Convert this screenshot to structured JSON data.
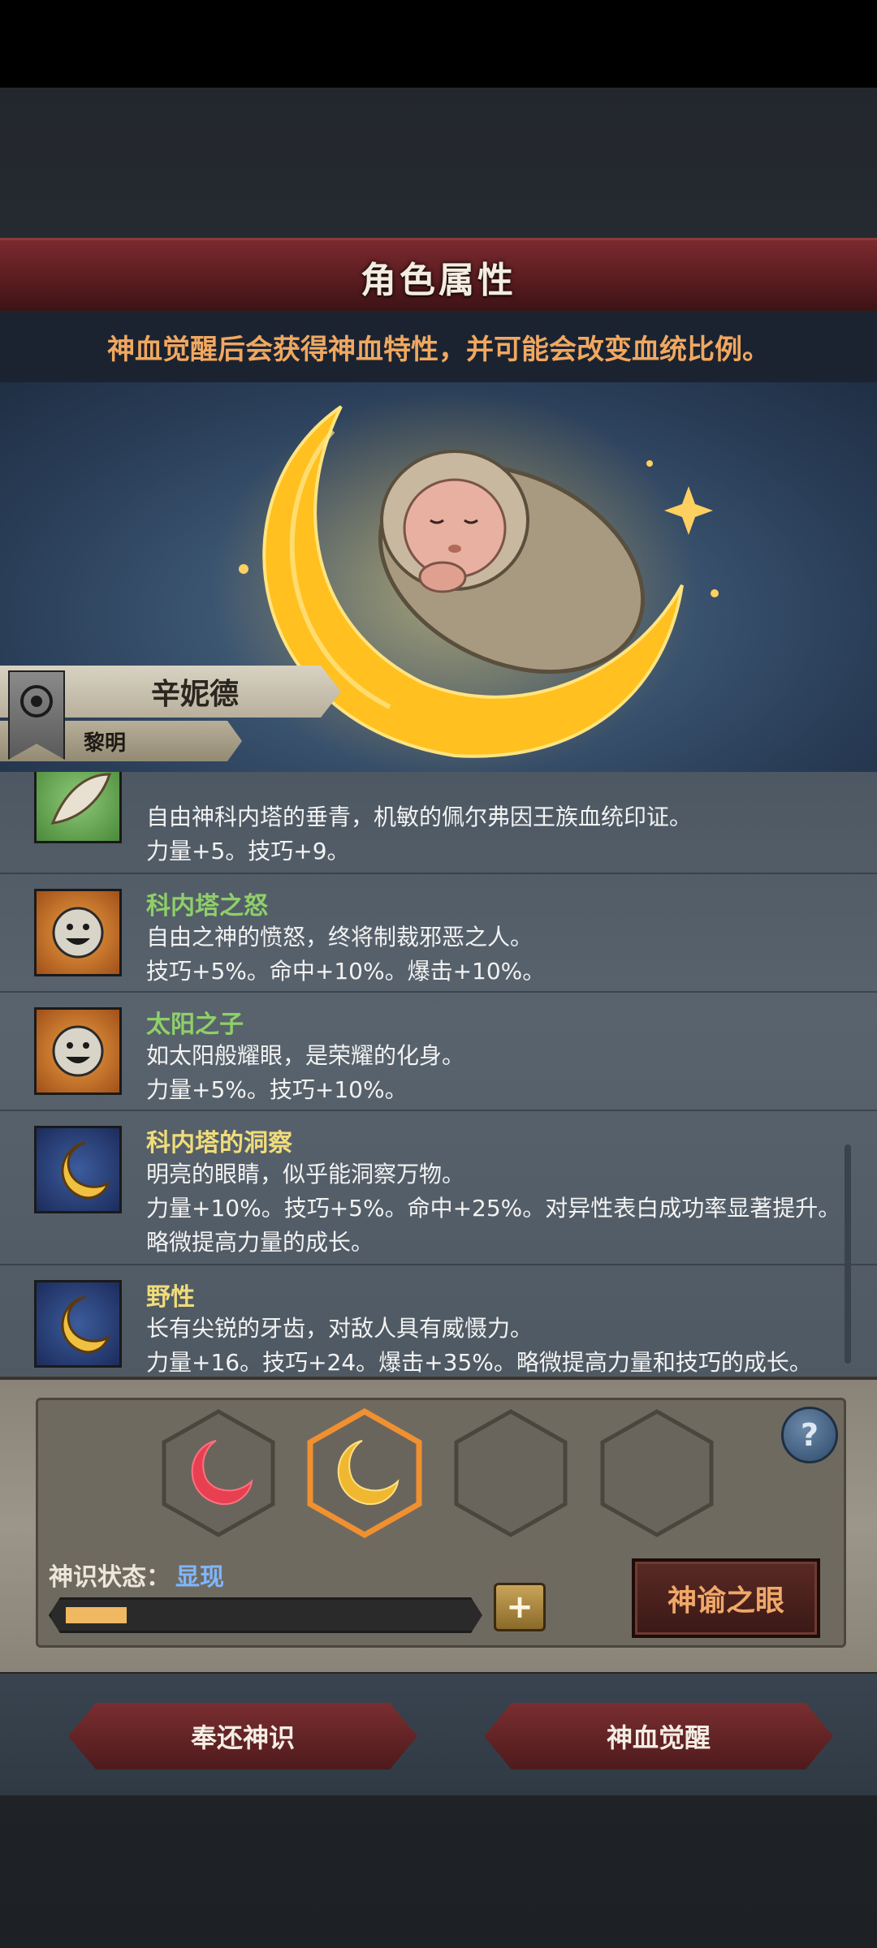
{
  "header": {
    "title": "角色属性"
  },
  "notice": "神血觉醒后会获得神血特性，并可能会改变血统比例。",
  "character": {
    "name": "辛妮德",
    "title": "黎明"
  },
  "traits": [
    {
      "name": "",
      "desc": "自由神科内塔的垂青，机敏的佩尔弗因王族血统印证。",
      "effect": "力量+5。技巧+9。",
      "extra": "",
      "name_color": "#8ed068",
      "icon": "feather-icon"
    },
    {
      "name": "科内塔之怒",
      "desc": "自由之神的愤怒，终将制裁邪恶之人。",
      "effect": "技巧+5%。命中+10%。爆击+10%。",
      "extra": "",
      "name_color": "#8ed068",
      "icon": "sun-face-icon"
    },
    {
      "name": "太阳之子",
      "desc": "如太阳般耀眼，是荣耀的化身。",
      "effect": "力量+5%。技巧+10%。",
      "extra": "",
      "name_color": "#8ed068",
      "icon": "sun-face-icon"
    },
    {
      "name": "科内塔的洞察",
      "desc": "明亮的眼睛，似乎能洞察万物。",
      "effect": "力量+10%。技巧+5%。命中+25%。对异性表白成功率显著提升。",
      "extra": "略微提高力量的成长。",
      "name_color": "#f0dc7a",
      "icon": "crescent-moon-icon"
    },
    {
      "name": "野性",
      "desc": "长有尖锐的牙齿，对敌人具有威慑力。",
      "effect": "力量+16。技巧+24。爆击+35%。略微提高力量和技巧的成长。",
      "extra": "",
      "name_color": "#f0dc7a",
      "icon": "crescent-moon-icon"
    }
  ],
  "panel": {
    "help": "?",
    "status_label": "神识状态：",
    "status_value": "显现",
    "progress": 0.15,
    "plus": "+",
    "oracle_button": "神谕之眼",
    "slots": [
      "red-crescent",
      "gold-crescent",
      "empty",
      "empty"
    ]
  },
  "actions": {
    "return": "奉还神识",
    "awaken": "神血觉醒"
  },
  "colors": {
    "accent": "#f0a860",
    "header": "#6b2428",
    "status": "#7fb6ff"
  }
}
